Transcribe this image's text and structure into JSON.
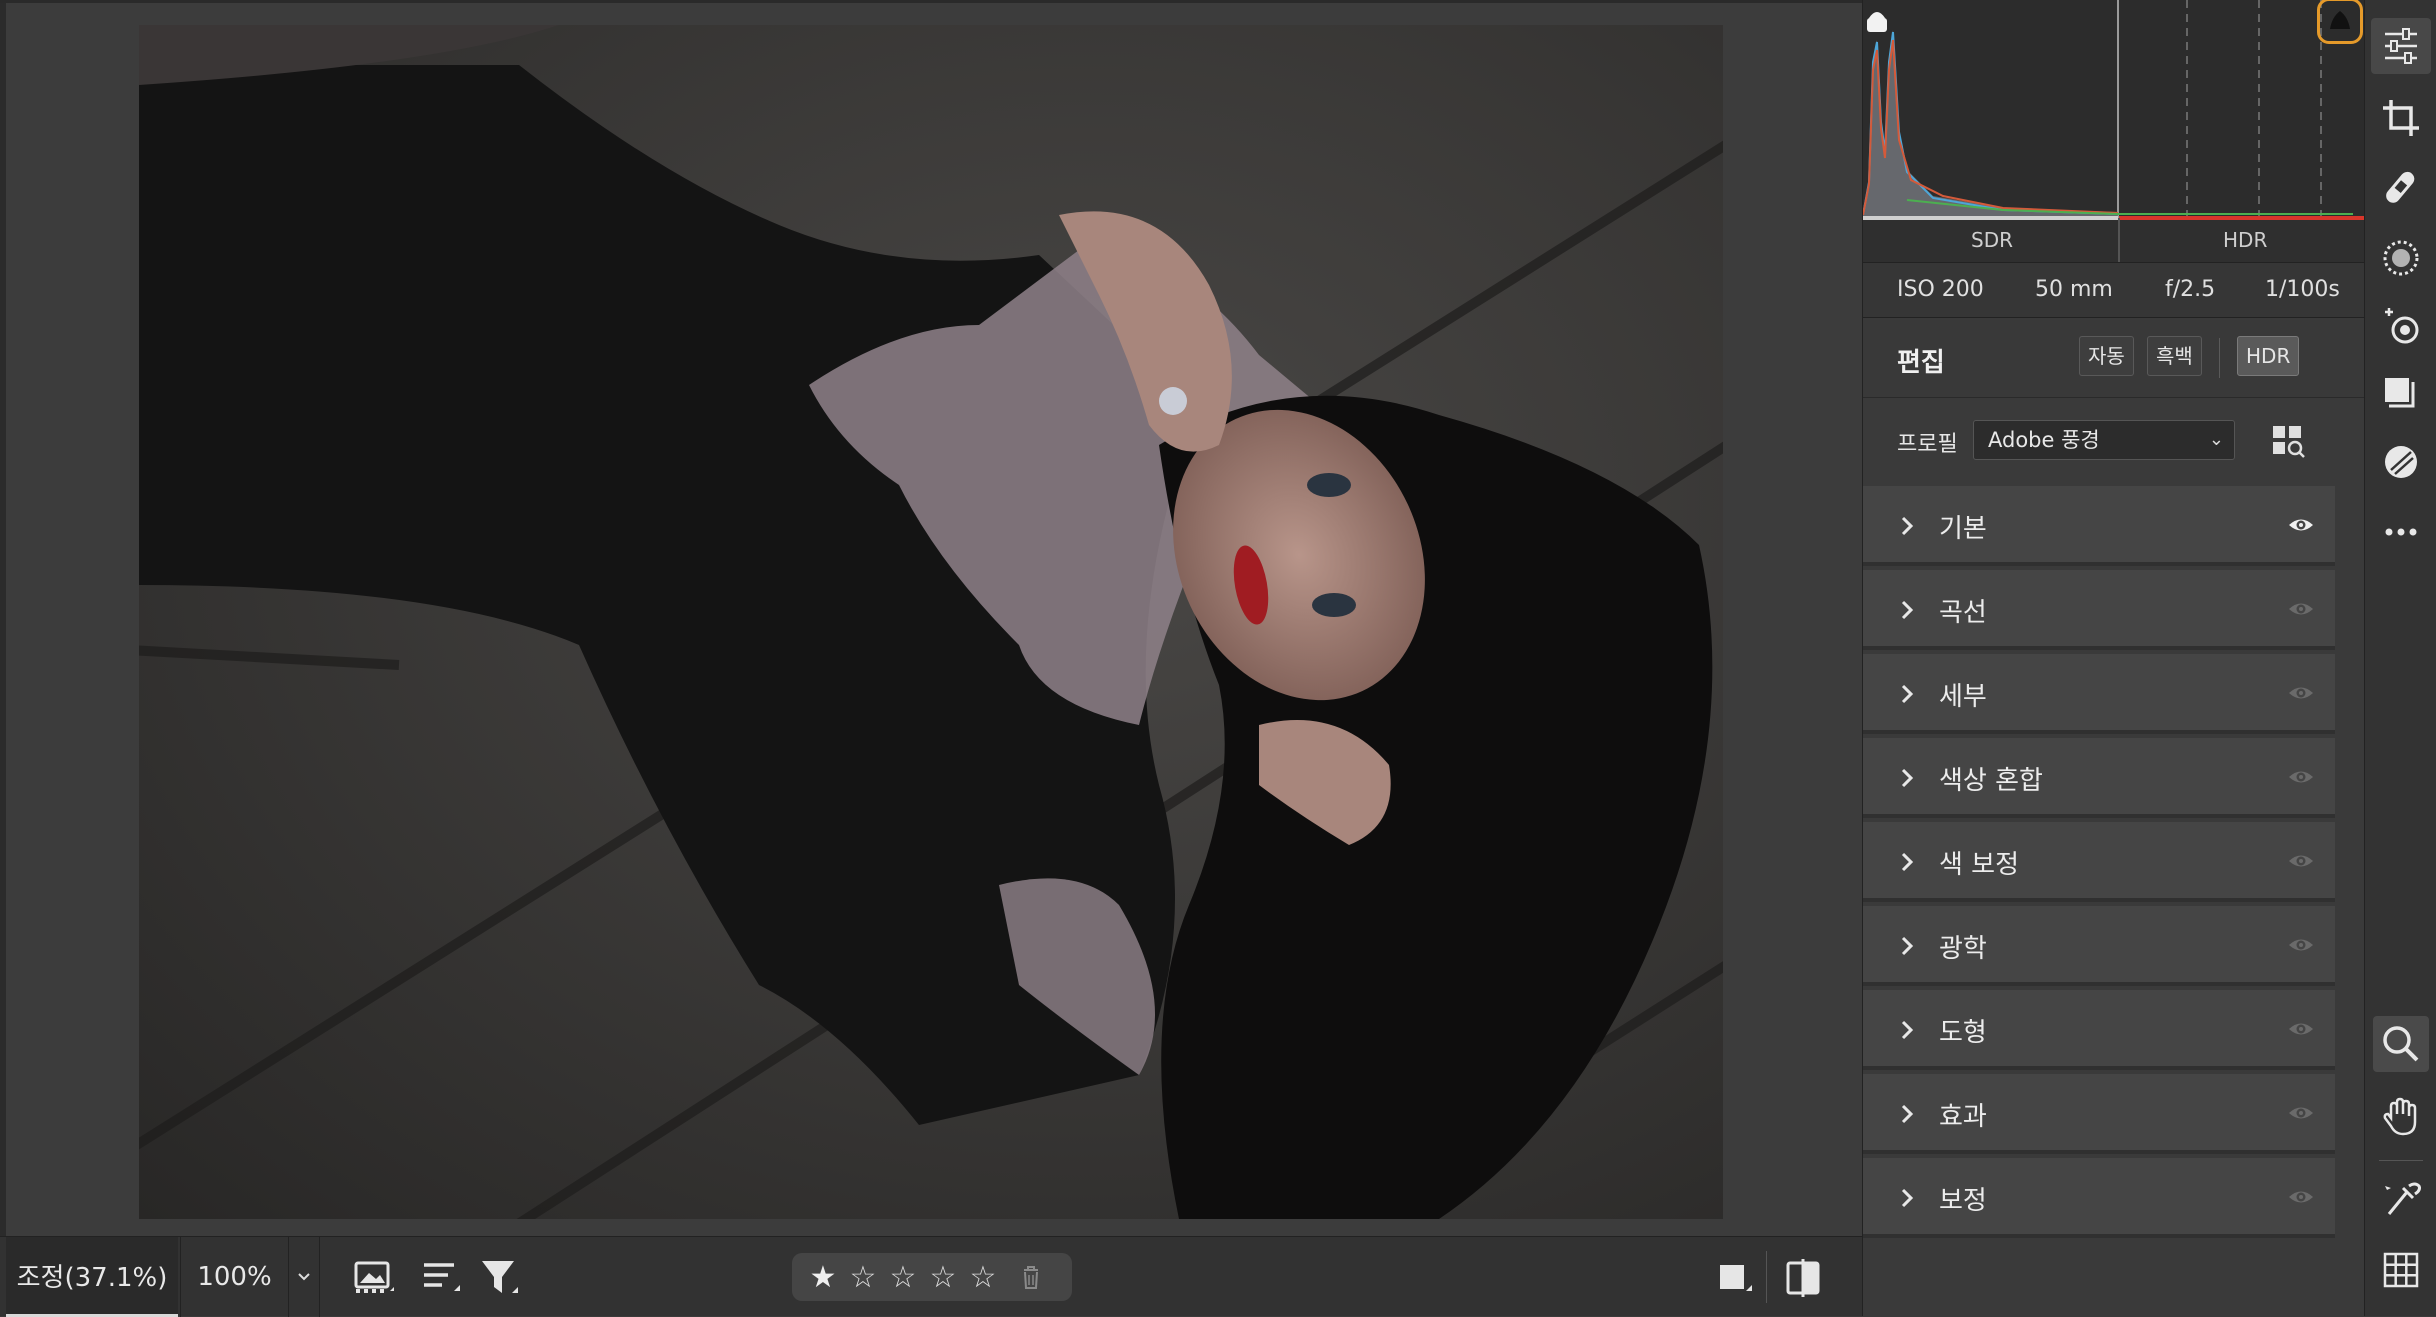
{
  "photo": {
    "alt": "portrait"
  },
  "bottom_bar": {
    "zoom_fit_label": "조정(37.1%)",
    "zoom_100_label": "100%",
    "zoom_dropdown": "⌄",
    "rating_stars": 1,
    "rating_max": 5
  },
  "histogram": {
    "sdr_label": "SDR",
    "hdr_label": "HDR"
  },
  "exif": {
    "iso": "ISO 200",
    "focal": "50 mm",
    "aperture": "f/2.5",
    "shutter": "1/100s"
  },
  "edit": {
    "title": "편집",
    "auto_label": "자동",
    "bw_label": "흑백",
    "hdr_label": "HDR",
    "profile_label": "프로필",
    "profile_value": "Adobe 풍경"
  },
  "sections": [
    {
      "label": "기본",
      "visible_active": true
    },
    {
      "label": "곡선",
      "visible_active": false
    },
    {
      "label": "세부",
      "visible_active": false
    },
    {
      "label": "색상 혼합",
      "visible_active": false
    },
    {
      "label": "색 보정",
      "visible_active": false
    },
    {
      "label": "광학",
      "visible_active": false
    },
    {
      "label": "도형",
      "visible_active": false
    },
    {
      "label": "효과",
      "visible_active": false
    },
    {
      "label": "보정",
      "visible_active": false
    }
  ],
  "colors": {
    "accent_orange": "#e59a2a",
    "hdr_red": "#d9362b"
  }
}
